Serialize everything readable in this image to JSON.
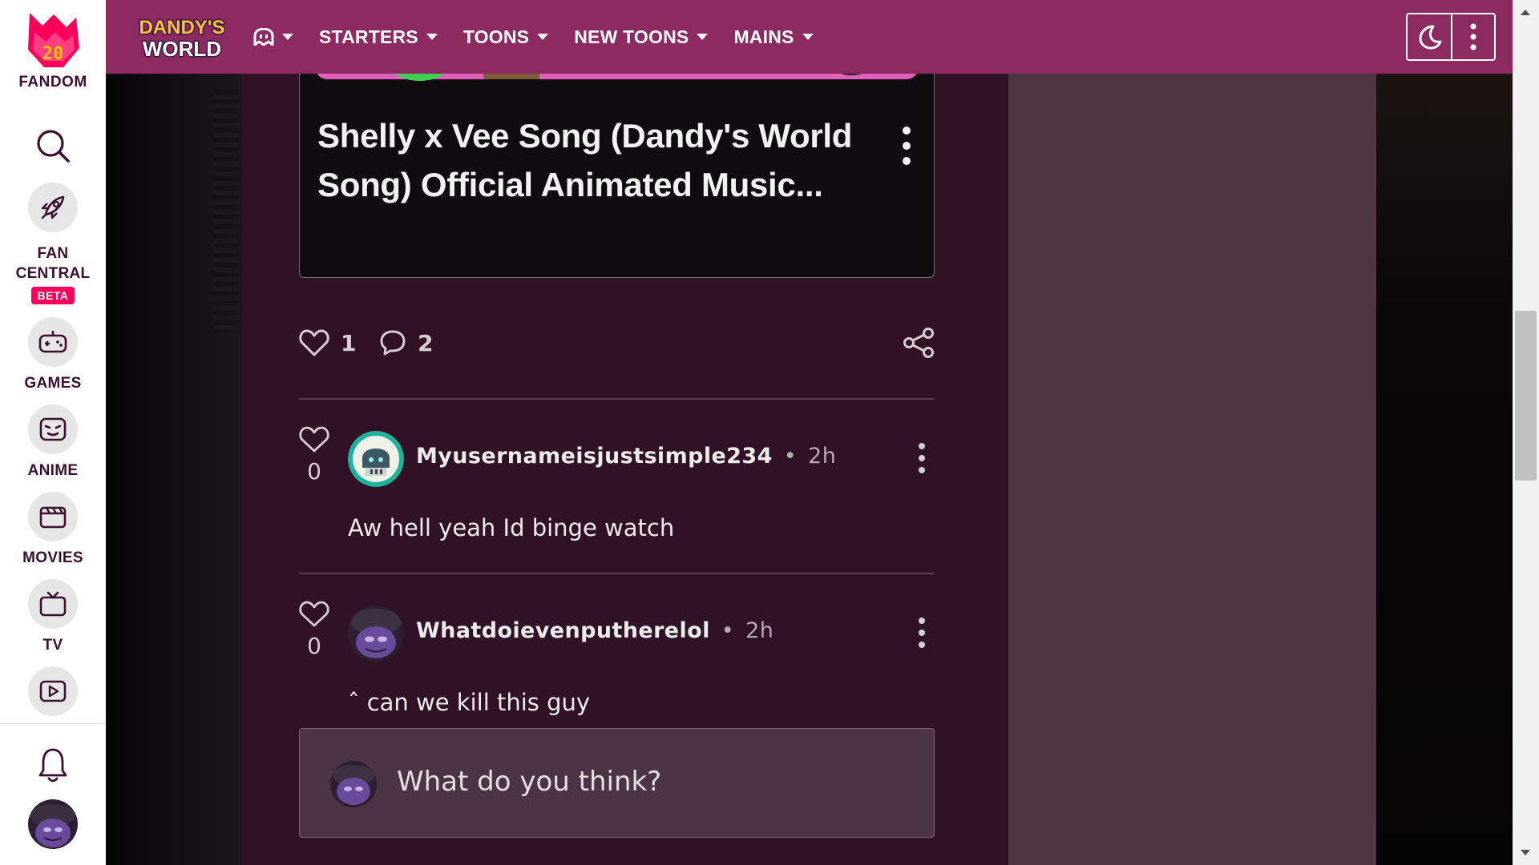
{
  "global_nav": {
    "logo_badge": "20",
    "logo_text": "FANDOM",
    "items": [
      {
        "label": "FAN CENTRAL",
        "line1": "FAN",
        "line2": "CENTRAL",
        "badge": "BETA",
        "icon": "rocket-icon"
      },
      {
        "label": "GAMES",
        "icon": "gamepad-icon"
      },
      {
        "label": "ANIME",
        "icon": "anime-face-icon"
      },
      {
        "label": "MOVIES",
        "icon": "clapperboard-icon"
      },
      {
        "label": "TV",
        "icon": "television-icon"
      },
      {
        "label": "",
        "icon": "video-play-icon"
      }
    ]
  },
  "header": {
    "wiki_logo_line1": "DANDY'S",
    "wiki_logo_line2": "WORLD",
    "nav": [
      {
        "label": "",
        "icon": "wiki-ghost-icon"
      },
      {
        "label": "STARTERS"
      },
      {
        "label": "TOONS"
      },
      {
        "label": "NEW TOONS"
      },
      {
        "label": "MAINS"
      }
    ]
  },
  "post": {
    "video_title": "Shelly x Vee Song (Dandy's World Song) Official Animated Music...",
    "likes": "1",
    "comments": "2"
  },
  "comments": [
    {
      "likes": "0",
      "author": "Myusernameisjustsimple234",
      "time": "2h",
      "body": "Aw hell yeah Id binge watch"
    },
    {
      "likes": "0",
      "author": "Whatdoievenputherelol",
      "time": "2h",
      "body": "ˆ can we kill this guy"
    }
  ],
  "reply": {
    "placeholder": "What do you think?"
  },
  "colors": {
    "header": "#8e2a62",
    "main_bg": "#311126",
    "rail_bg": "#4d3543",
    "fandom_pink": "#fa005a"
  }
}
